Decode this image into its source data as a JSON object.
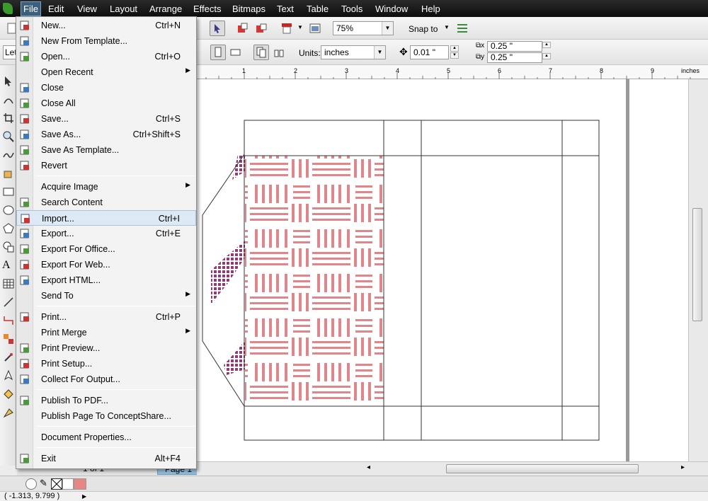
{
  "menubar": {
    "items": [
      "File",
      "Edit",
      "View",
      "Layout",
      "Arrange",
      "Effects",
      "Bitmaps",
      "Text",
      "Table",
      "Tools",
      "Window",
      "Help"
    ],
    "active": "File"
  },
  "toolbar": {
    "zoom_value": "75%",
    "snap_label": "Snap to",
    "paper_partial": "Let",
    "units_label": "Units:",
    "units_value": "inches",
    "nudge_value": "0.01 \"",
    "dup_x": "0.25 \"",
    "dup_y": "0.25 \""
  },
  "ruler": {
    "unit": "inches",
    "labels": [
      "1",
      "2",
      "3",
      "4",
      "5",
      "6",
      "7",
      "8",
      "9"
    ]
  },
  "file_menu": {
    "items": [
      {
        "label": "New...",
        "shortcut": "Ctrl+N",
        "icon": "new-document-icon"
      },
      {
        "label": "New From Template...",
        "shortcut": "",
        "icon": "template-icon"
      },
      {
        "label": "Open...",
        "shortcut": "Ctrl+O",
        "icon": "open-folder-icon"
      },
      {
        "label": "Open Recent",
        "shortcut": "",
        "submenu": true
      },
      {
        "label": "Close",
        "shortcut": "",
        "icon": "close-document-icon"
      },
      {
        "label": "Close All",
        "shortcut": "",
        "icon": "close-all-icon"
      },
      {
        "label": "Save...",
        "shortcut": "Ctrl+S",
        "icon": "save-icon"
      },
      {
        "label": "Save As...",
        "shortcut": "Ctrl+Shift+S",
        "icon": "save-as-icon"
      },
      {
        "label": "Save As Template...",
        "shortcut": "",
        "icon": "save-template-icon"
      },
      {
        "label": "Revert",
        "shortcut": "",
        "icon": "revert-icon"
      },
      {
        "label": "Acquire Image",
        "shortcut": "",
        "submenu": true
      },
      {
        "label": "Search Content",
        "shortcut": "",
        "icon": "search-content-icon"
      },
      {
        "label": "Import...",
        "shortcut": "Ctrl+I",
        "icon": "import-icon",
        "highlighted": true
      },
      {
        "label": "Export...",
        "shortcut": "Ctrl+E",
        "icon": "export-icon"
      },
      {
        "label": "Export For Office...",
        "shortcut": "",
        "icon": "export-office-icon"
      },
      {
        "label": "Export For Web...",
        "shortcut": "",
        "icon": "export-web-icon"
      },
      {
        "label": "Export HTML...",
        "shortcut": "",
        "icon": "export-html-icon"
      },
      {
        "label": "Send To",
        "shortcut": "",
        "submenu": true
      },
      {
        "label": "Print...",
        "shortcut": "Ctrl+P",
        "icon": "print-icon"
      },
      {
        "label": "Print Merge",
        "shortcut": "",
        "submenu": true
      },
      {
        "label": "Print Preview...",
        "shortcut": "",
        "icon": "print-preview-icon"
      },
      {
        "label": "Print Setup...",
        "shortcut": "",
        "icon": "print-setup-icon"
      },
      {
        "label": "Collect For Output...",
        "shortcut": "",
        "icon": "collect-output-icon"
      },
      {
        "label": "Publish To PDF...",
        "shortcut": "",
        "icon": "pdf-icon"
      },
      {
        "label": "Publish Page To ConceptShare...",
        "shortcut": "",
        "icon": ""
      },
      {
        "label": "Document Properties...",
        "shortcut": "",
        "icon": ""
      },
      {
        "label": "Exit",
        "shortcut": "Alt+F4",
        "icon": "exit-icon"
      }
    ]
  },
  "page_nav": {
    "page_count": "1 of 1",
    "page_tab": "Page 1"
  },
  "status": {
    "cursor": "( -1.313, 9.799 )"
  },
  "colors": {
    "pattern_pink": "#e0868b",
    "pattern_purple": "#8e3b78",
    "swatch": "#e88686"
  }
}
